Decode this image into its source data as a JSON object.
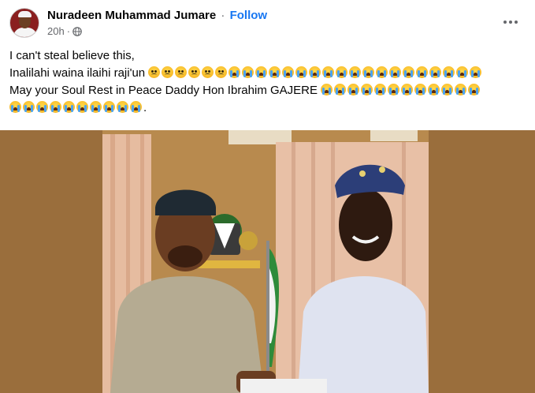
{
  "post": {
    "author": "Nuradeen Muhammad Jumare",
    "separator": "·",
    "follow_label": "Follow",
    "time": "20h",
    "audience_icon": "globe-icon",
    "more_icon": "more-options-icon",
    "lines": [
      "I can't steal believe this,",
      "Inalilahi waina ilaihi raji'un",
      "May your Soul Rest in Peace Daddy Hon Ibrahim GAJERE"
    ],
    "line2_emojis": {
      "sad": 6,
      "cry": 19
    },
    "line3_emojis": {
      "cry": 12
    },
    "line4_emojis": {
      "cry": 10
    },
    "line4_suffix": "."
  },
  "photo": {
    "subject": "two men holding a document in an office with a flag and coat of arms",
    "colors": {
      "background": "#9a6e3c",
      "curtain": "#e6bca0",
      "wall": "#b88a4e"
    }
  }
}
